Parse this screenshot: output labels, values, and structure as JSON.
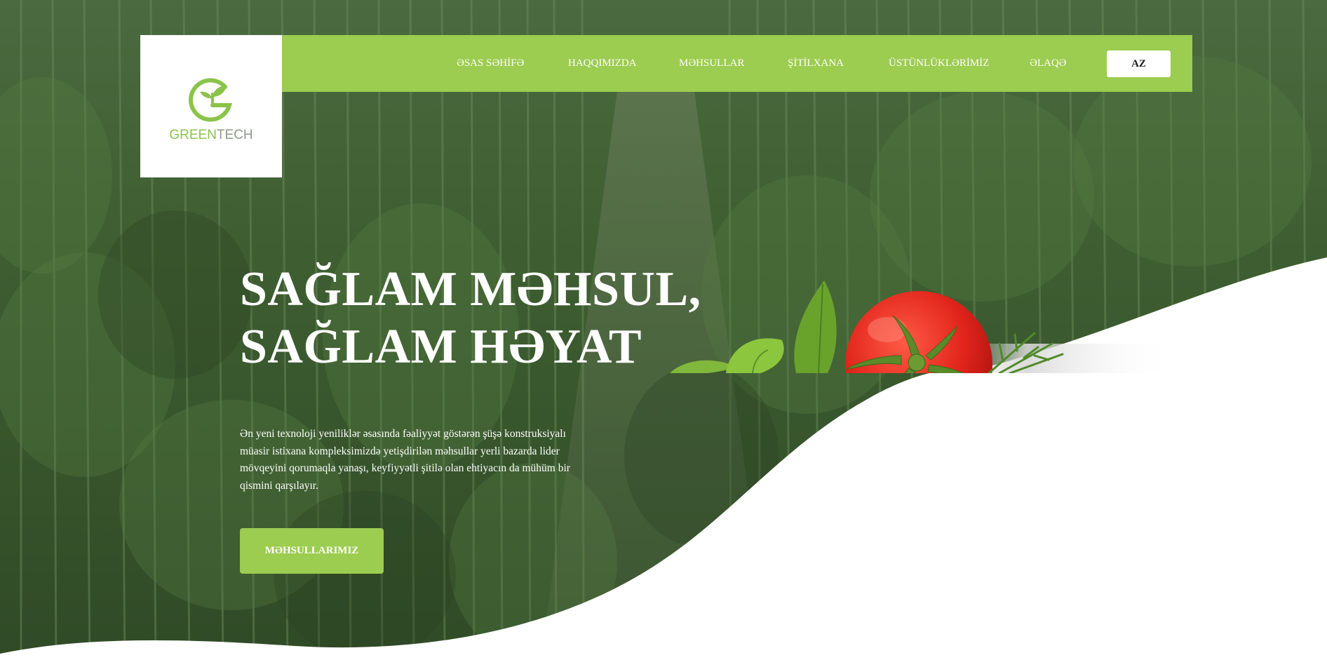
{
  "brand": {
    "name_green": "GREEN",
    "name_tech": "TECH",
    "logo_icon": "greentech-g-leaf-icon"
  },
  "nav": {
    "items": [
      {
        "label": "ƏSAS SƏHİFƏ"
      },
      {
        "label": "HAQQIMIZDA"
      },
      {
        "label": "MƏHSULLAR"
      },
      {
        "label": "ŞİTİLXANA"
      },
      {
        "label": "ÜSTÜNLÜKLƏRİMİZ"
      },
      {
        "label": "ƏLAQƏ"
      }
    ],
    "language": "AZ"
  },
  "hero": {
    "headline_line1": "SAĞLAM MƏHSUL,",
    "headline_line2": "SAĞLAM HƏYAT",
    "description": "Ən yeni texnoloji yeniliklər əsasında fəaliyyət göstərən şüşə konstruksiyalı müasir istixana kompleksimizdə yetişdirilən məhsullar yerli bazarda lider mövqeyini qorumaqla yanaşı, keyfiyyətli şitilə olan ehtiyacın da mühüm bir qismini qarşılayır.",
    "cta_label": "MƏHSULLARIMIZ"
  },
  "colors": {
    "accent": "#9ccc50",
    "overlay": "#3a5a2c",
    "tomato": "#e0241b"
  }
}
